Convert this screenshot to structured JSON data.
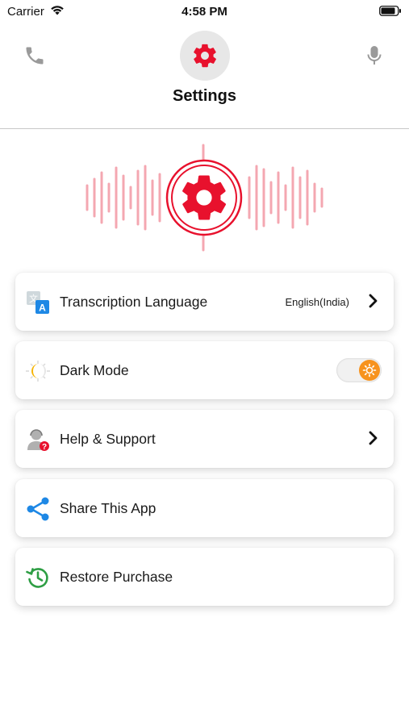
{
  "status_bar": {
    "carrier": "Carrier",
    "time": "4:58 PM"
  },
  "header": {
    "title": "Settings",
    "left_icon": "phone-icon",
    "right_icon": "microphone-icon",
    "center_icon": "gear-icon"
  },
  "settings": {
    "transcription": {
      "label": "Transcription Language",
      "value": "English(India)",
      "icon": "translate-icon"
    },
    "dark_mode": {
      "label": "Dark Mode",
      "icon": "moon-sun-icon",
      "toggle_on": true
    },
    "help": {
      "label": "Help & Support",
      "icon": "support-agent-icon"
    },
    "share": {
      "label": "Share This App",
      "icon": "share-icon"
    },
    "restore": {
      "label": "Restore Purchase",
      "icon": "restore-icon"
    }
  },
  "colors": {
    "accent": "#e8112d",
    "toggle_knob": "#f7931e",
    "share_blue": "#1e88e5",
    "restore_green": "#2e9e44"
  }
}
